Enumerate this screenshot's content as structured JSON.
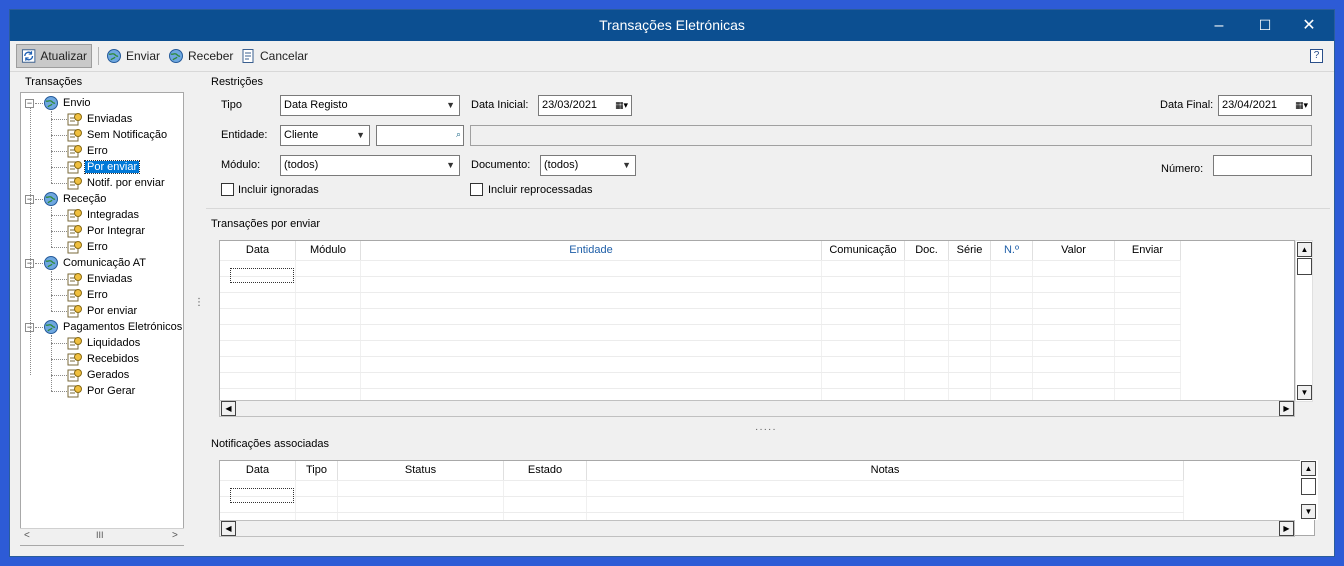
{
  "window": {
    "title": "Transações Eletrónicas",
    "controls": {
      "minimize": "–",
      "maximize": "☐",
      "close": "✕"
    }
  },
  "toolbar": {
    "atualizar": "Atualizar",
    "enviar": "Enviar",
    "receber": "Receber",
    "cancelar": "Cancelar",
    "help": "?"
  },
  "tree": {
    "label": "Transações",
    "groups": [
      {
        "label": "Envio",
        "items": [
          "Enviadas",
          "Sem Notificação",
          "Erro",
          "Por enviar",
          "Notif. por enviar"
        ]
      },
      {
        "label": "Receção",
        "items": [
          "Integradas",
          "Por Integrar",
          "Erro"
        ]
      },
      {
        "label": "Comunicação AT",
        "items": [
          "Enviadas",
          "Erro",
          "Por enviar"
        ]
      },
      {
        "label": "Pagamentos Eletrónicos",
        "items": [
          "Liquidados",
          "Recebidos",
          "Gerados",
          "Por Gerar"
        ]
      }
    ],
    "selected": "Por enviar",
    "scroll_thumb": "III"
  },
  "restricoes": {
    "title": "Restrições",
    "tipo_label": "Tipo",
    "tipo_value": "Data Registo",
    "data_inicial_label": "Data Inicial:",
    "data_inicial_value": "23/03/2021",
    "data_final_label": "Data Final:",
    "data_final_value": "23/04/2021",
    "entidade_label": "Entidade:",
    "entidade_value": "Cliente",
    "modulo_label": "Módulo:",
    "modulo_value": "(todos)",
    "documento_label": "Documento:",
    "documento_value": "(todos)",
    "numero_label": "Número:",
    "incluir_ignoradas": "Incluir ignoradas",
    "incluir_reprocessadas": "Incluir reprocessadas"
  },
  "transacoes": {
    "title": "Transações por enviar",
    "columns": [
      "Data",
      "Módulo",
      "Entidade",
      "Comunicação",
      "Doc.",
      "Série",
      "N.º",
      "Valor",
      "Enviar"
    ]
  },
  "notificacoes": {
    "title": "Notificações associadas",
    "columns": [
      "Data",
      "Tipo",
      "Status",
      "Estado",
      "Notas"
    ]
  },
  "colors": {
    "titlebar": "#0c4f91",
    "selection": "#0078d7",
    "link_header": "#1f5fa8",
    "background": "#2d5bd6"
  }
}
